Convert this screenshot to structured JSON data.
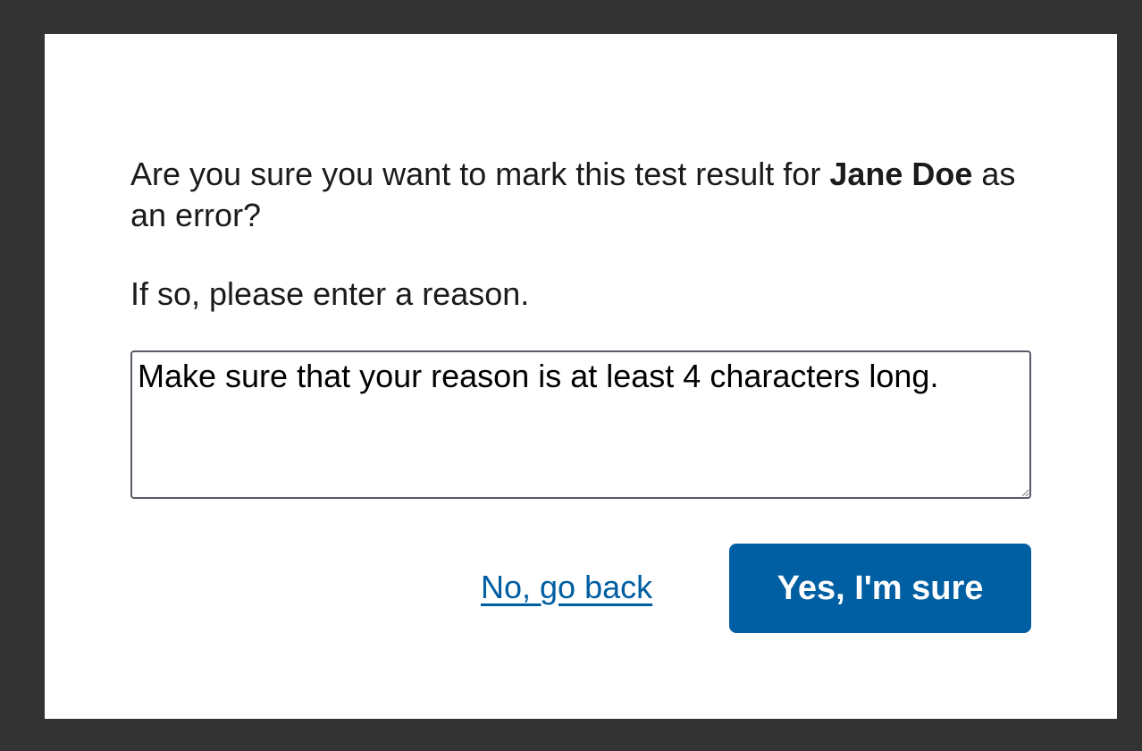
{
  "dialog": {
    "question_prefix": "Are you sure you want to mark this test result for ",
    "patient_name": "Jane Doe",
    "question_suffix": " as an error?",
    "instruction": "If so, please enter a reason.",
    "reason_input": {
      "value": "",
      "placeholder": "Make sure that your reason is at least 4 characters long."
    },
    "cancel_label": "No, go back",
    "confirm_label": "Yes, I'm sure"
  },
  "colors": {
    "backdrop": "#333333",
    "primary": "#005ea2",
    "text": "#1b1b1b"
  }
}
